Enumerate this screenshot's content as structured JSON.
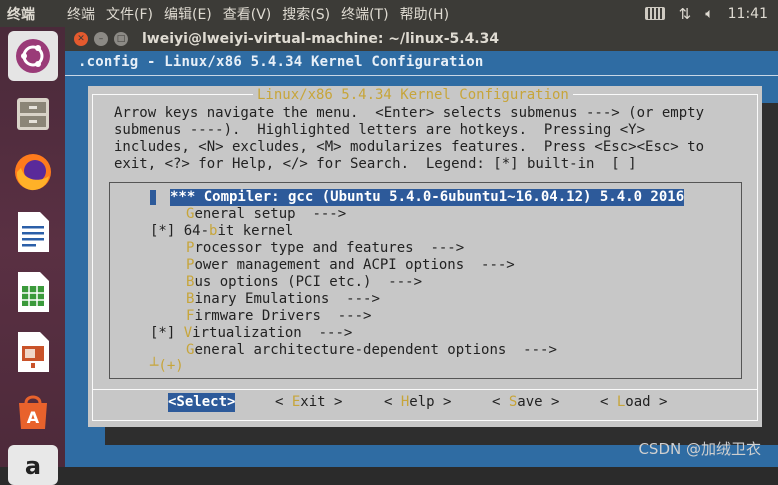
{
  "top_panel": {
    "app_name": "终端",
    "menu": [
      "终端",
      "文件(F)",
      "编辑(E)",
      "查看(V)",
      "搜索(S)",
      "终端(T)",
      "帮助(H)"
    ],
    "clock": "11:41",
    "indicators": [
      "keyboard-icon",
      "network-icon",
      "volume-icon"
    ]
  },
  "launcher": {
    "items": [
      "ubuntu-logo-icon",
      "files-icon",
      "firefox-icon",
      "writer-icon",
      "calc-icon",
      "impress-icon",
      "software-center-icon",
      "amazon-icon"
    ]
  },
  "window": {
    "title": "lweiyi@lweiyi-virtual-machine: ~/linux-5.4.34"
  },
  "terminal": {
    "config_line": ".config - Linux/x86 5.4.34 Kernel Configuration",
    "dialog_title": "Linux/x86 5.4.34 Kernel Configuration",
    "help_text": "Arrow keys navigate the menu.  <Enter> selects submenus ---> (or empty\nsubmenus ----).  Highlighted letters are hotkeys.  Pressing <Y>\nincludes, <N> excludes, <M> modularizes features.  Press <Esc><Esc> to\nexit, <?> for Help, </> for Search.  Legend: [*] built-in  [ ]",
    "menu_items": [
      {
        "prefix": "",
        "hotkey": "",
        "text": "*** Compiler: gcc (Ubuntu 5.4.0-6ubuntu1~16.04.12) 5.4.0 2016",
        "selected": true
      },
      {
        "prefix": "",
        "hotkey": "G",
        "text": "eneral setup  --->",
        "selected": false
      },
      {
        "prefix": "[*] ",
        "hotkey": "",
        "text": "64-",
        "hotkey2": "b",
        "text2": "it kernel",
        "selected": false
      },
      {
        "prefix": "",
        "hotkey": "P",
        "text": "rocessor type and features  --->",
        "selected": false
      },
      {
        "prefix": "",
        "hotkey": "P",
        "text": "ower management and ACPI options  --->",
        "selected": false
      },
      {
        "prefix": "",
        "hotkey": "B",
        "text": "us options (PCI etc.)  --->",
        "selected": false
      },
      {
        "prefix": "",
        "hotkey": "B",
        "text": "inary Emulations  --->",
        "selected": false
      },
      {
        "prefix": "",
        "hotkey": "F",
        "text": "irmware Drivers  --->",
        "selected": false
      },
      {
        "prefix": "[*] ",
        "hotkey": "V",
        "text": "irtualization  --->",
        "selected": false
      },
      {
        "prefix": "",
        "hotkey": "G",
        "text": "eneral architecture-dependent options  --->",
        "selected": false
      }
    ],
    "more_indicator": "┴(+)",
    "buttons": [
      {
        "label": "<Select>",
        "active": true
      },
      {
        "pre": "< ",
        "hotkey": "E",
        "post": "xit >",
        "active": false
      },
      {
        "pre": "< ",
        "hotkey": "H",
        "post": "elp >",
        "active": false
      },
      {
        "pre": "< ",
        "hotkey": "S",
        "post": "ave >",
        "active": false
      },
      {
        "pre": "< ",
        "hotkey": "L",
        "post": "oad >",
        "active": false
      }
    ]
  },
  "watermark": "CSDN @加绒卫衣",
  "colors": {
    "panel": "#3c3b37",
    "terminal_bg": "#2f6ca3",
    "dialog_bg": "#c7c7c7",
    "highlight": "#2d5a9a",
    "hotkey": "#c7a53a"
  }
}
